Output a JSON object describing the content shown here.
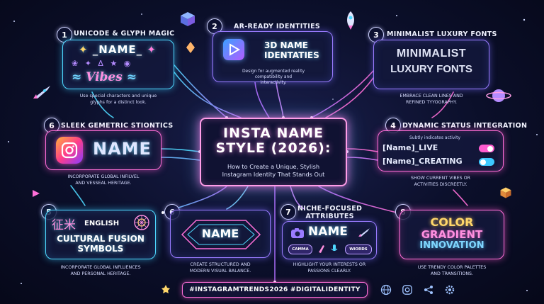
{
  "header": {
    "title_line1": "INSTA NAME",
    "title_line2": "STYLE (2026):",
    "subtitle_line1": "How to Create a Unique, Stylish",
    "subtitle_line2": "Instagram Identity That Stands Out"
  },
  "cards": [
    {
      "number": "1",
      "title": "Unicode & Glyph Magic",
      "sample": "_NAME_",
      "glyph_row": "❀ ✦ Δ ★ ◉",
      "vibes": "Vibes",
      "desc_line1": "Use special characters and unique",
      "desc_line2": "glyphs for a distinct look."
    },
    {
      "number": "2",
      "title": "AR-Ready Identities",
      "sample_line1": "3D NAME",
      "sample_line2": "IDENTATIES",
      "desc_line1": "Design for augmented reality",
      "desc_line2": "compatibility and",
      "desc_line3": "interactivity."
    },
    {
      "number": "3",
      "title": "Minimalist Luxury Fonts",
      "sample_line1": "MINIMALIST",
      "sample_line2": "LUXURY FONTS",
      "desc_line1": "Embrace clean lines and",
      "desc_line2": "refined tyyography."
    },
    {
      "number": "4",
      "title": "Dynamic Status Integration",
      "note": "Subtly indicates activity",
      "status1": "[Name]_LIVE",
      "status2": "[Name]_CREATING",
      "desc_line1": "Show current vibes or",
      "desc_line2": "activities discreetly."
    },
    {
      "number": "5",
      "title": "",
      "glyphs": "征米",
      "english": "ENGLISH",
      "sample_line1": "CULTURAL FUSION",
      "sample_line2": "SYMBOLS",
      "desc_line1": "Incorporate global influences",
      "desc_line2": "and personal heritage."
    },
    {
      "number": "6",
      "title": "",
      "sample": "NAME",
      "desc_line1": "Create structured and",
      "desc_line2": "modern visual balance."
    },
    {
      "number": "6",
      "title": "Sleek Gemetric Stiontics",
      "sample": "NAME",
      "desc_line1": "Incorporate global infilvel",
      "desc_line2": "and vesseal heritage."
    },
    {
      "number": "7",
      "title_line1": "Niche-Focused",
      "title_line2": "Attributes",
      "sample": "NAME",
      "tag1": "CAMMA",
      "tag2": "WIORDS",
      "desc_line1": "Highlight your interests or",
      "desc_line2": "passions clearly."
    },
    {
      "number": "8",
      "sample_line1": "COLOR",
      "sample_line2": "GRADIENT",
      "sample_line3": "INNOVATION",
      "desc_line1": "Use trendy color palettes",
      "desc_line2": "and transitions."
    }
  ],
  "footer": {
    "hashtags": "#INSTAGRAMTRENDS2026 #DIGITALIDENTITY"
  },
  "icons": [
    "instagram-icon",
    "rocket-icon",
    "planet-icon",
    "cube-icon",
    "globe-icon",
    "paintbrush-icon",
    "camera-icon"
  ],
  "colors": {
    "cyan": "#4fd9ff",
    "purple": "#9a7bff",
    "pink": "#ff6fd8",
    "background": "#0b0f2a"
  }
}
